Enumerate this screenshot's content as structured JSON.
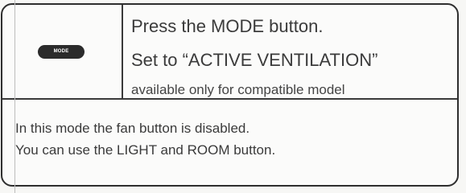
{
  "mode_button": {
    "label": "MODE"
  },
  "instructions": {
    "line1": "Press the MODE button.",
    "line2": "Set to “ACTIVE VENTILATION”",
    "line3": "available only for compatible model"
  },
  "notes": {
    "line1": "In this mode the fan button is disabled.",
    "line2": "You can use the LIGHT and ROOM button."
  }
}
